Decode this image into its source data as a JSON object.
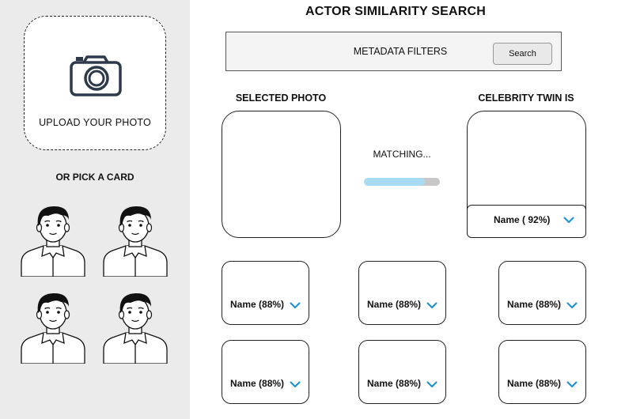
{
  "sidebar": {
    "upload_label": "UPLOAD YOUR PHOTO",
    "upload_icon": "camera-icon",
    "pick_title": "OR PICK A CARD",
    "card_icon": "person-avatar-icon",
    "card_count": 4
  },
  "header": {
    "title": "ACTOR SIMILARITY SEARCH"
  },
  "filters": {
    "label": "METADATA FILTERS",
    "search_label": "Search"
  },
  "selected": {
    "label": "SELECTED PHOTO"
  },
  "matching": {
    "label": "MATCHING...",
    "progress": 0.8
  },
  "twin": {
    "label": "CELEBRITY TWIN IS",
    "name": "Name ( 92%)"
  },
  "results": [
    {
      "name": "Name (88%)"
    },
    {
      "name": "Name (88%)"
    },
    {
      "name": "Name (88%)"
    },
    {
      "name": "Name (88%)"
    },
    {
      "name": "Name (88%)"
    },
    {
      "name": "Name (88%)"
    }
  ],
  "colors": {
    "sidebar_bg": "#ebebeb",
    "progress_fill": "#a9dcf4",
    "progress_track": "#c8c8c8",
    "chevron": "#1a8fd1",
    "camera_stroke": "#2e3a4a"
  }
}
